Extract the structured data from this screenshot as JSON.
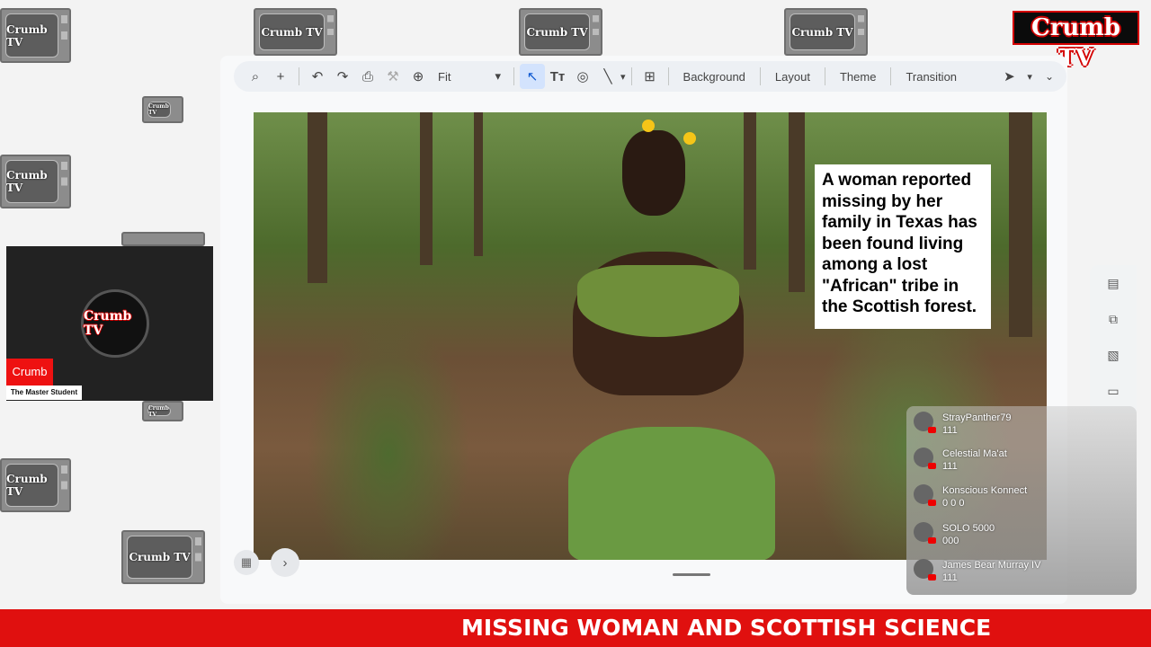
{
  "brand": {
    "name": "Crumb TV",
    "logo_text": "Crumb TV"
  },
  "toolbar": {
    "zoom_value": "Fit",
    "background_label": "Background",
    "layout_label": "Layout",
    "theme_label": "Theme",
    "transition_label": "Transition",
    "icons": [
      "search-icon",
      "add-icon",
      "undo-icon",
      "redo-icon",
      "print-icon",
      "paint-format-icon",
      "zoom-icon",
      "select-icon",
      "text-box-icon",
      "shape-icon",
      "line-icon",
      "comment-icon"
    ]
  },
  "slide": {
    "caption": "A woman reported missing by her family in Texas has been found living among a lost \"African\" tribe in the Scottish forest."
  },
  "chat": {
    "messages": [
      {
        "user": "StrayPanther79",
        "text": "111"
      },
      {
        "user": "Celestial Ma'at",
        "text": "111"
      },
      {
        "user": "Konscious Konnect",
        "text": "0 0 0"
      },
      {
        "user": "SOLO 5000",
        "text": "000"
      },
      {
        "user": "James Bear Murray IV",
        "text": "111"
      }
    ]
  },
  "webcam": {
    "name": "Crumb",
    "subtitle": "The Master Student"
  },
  "ticker": {
    "text": "MISSING WOMAN AND SCOTTISH SCIENCE"
  }
}
